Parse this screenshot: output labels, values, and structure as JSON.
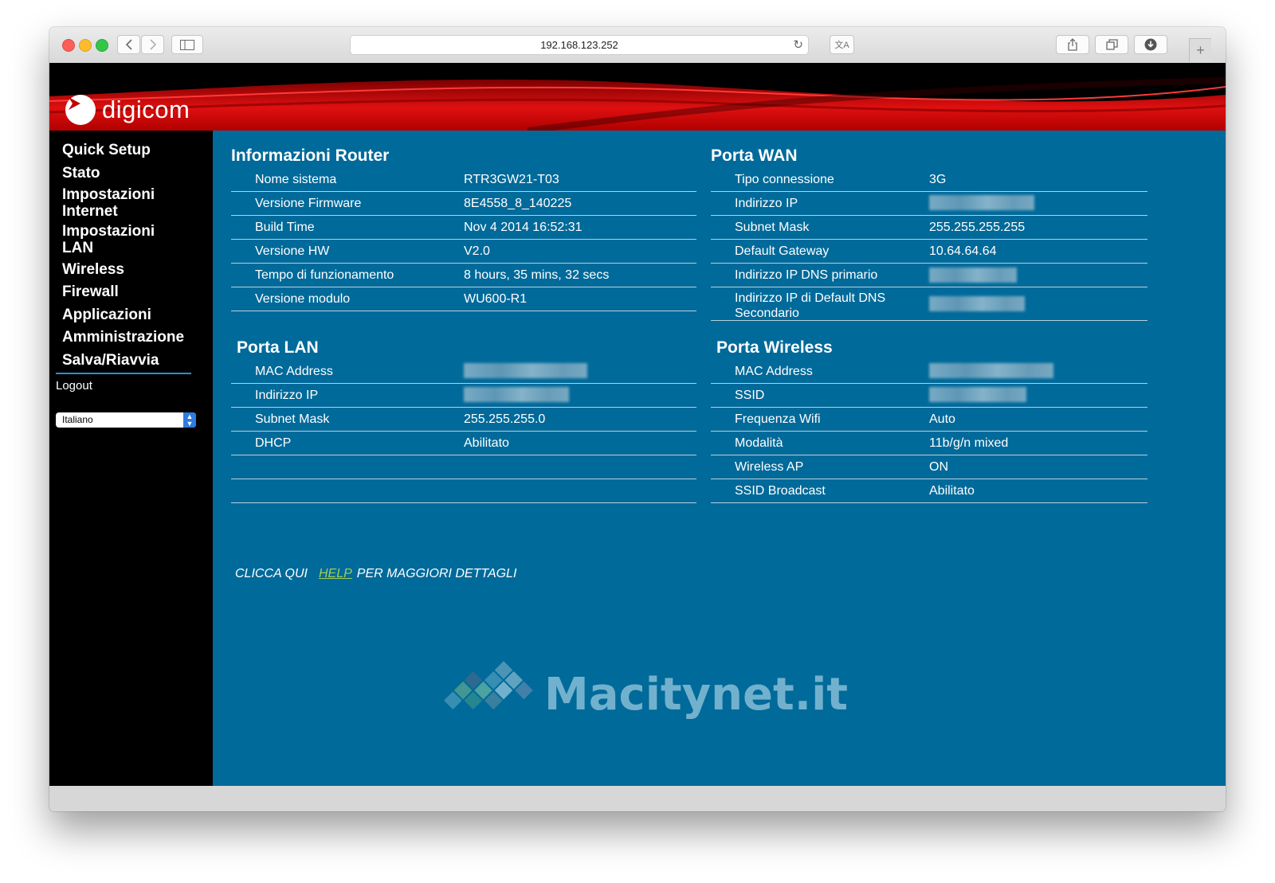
{
  "browser": {
    "url": "192.168.123.252"
  },
  "brand": {
    "logo_text": "digicom",
    "colors": {
      "banner_red": "#d40000",
      "content_bg": "#006a9a",
      "sidebar_bg": "#000000",
      "link_green": "#9fce55"
    }
  },
  "sidebar": {
    "items": [
      {
        "label": "Quick Setup"
      },
      {
        "label": "Stato"
      },
      {
        "label": "Impostazioni Internet"
      },
      {
        "label": "Impostazioni LAN"
      },
      {
        "label": "Wireless"
      },
      {
        "label": "Firewall"
      },
      {
        "label": "Applicazioni"
      },
      {
        "label": "Amministrazione"
      },
      {
        "label": "Salva/Riavvia"
      }
    ],
    "logout": "Logout",
    "language": "Italiano"
  },
  "router_info": {
    "title": "Informazioni Router",
    "rows": [
      {
        "label": "Nome sistema",
        "value": "RTR3GW21-T03"
      },
      {
        "label": "Versione Firmware",
        "value": "8E4558_8_140225"
      },
      {
        "label": "Build Time",
        "value": "Nov 4 2014 16:52:31"
      },
      {
        "label": "Versione HW",
        "value": "V2.0"
      },
      {
        "label": "Tempo di funzionamento",
        "value": "8 hours, 35 mins, 32 secs"
      },
      {
        "label": "Versione modulo",
        "value": "WU600-R1"
      }
    ]
  },
  "wan": {
    "title": "Porta WAN",
    "rows": [
      {
        "label": "Tipo connessione",
        "value": "3G"
      },
      {
        "label": "Indirizzo IP",
        "value": ""
      },
      {
        "label": "Subnet Mask",
        "value": "255.255.255.255"
      },
      {
        "label": "Default Gateway",
        "value": "10.64.64.64"
      },
      {
        "label": "Indirizzo IP DNS primario",
        "value": ""
      },
      {
        "label": "Indirizzo IP di Default DNS Secondario",
        "value": ""
      }
    ]
  },
  "lan": {
    "title": "Porta LAN",
    "rows": [
      {
        "label": "MAC Address",
        "value": ""
      },
      {
        "label": "Indirizzo IP",
        "value": ""
      },
      {
        "label": "Subnet Mask",
        "value": "255.255.255.0"
      },
      {
        "label": "DHCP",
        "value": "Abilitato"
      }
    ]
  },
  "wireless": {
    "title": "Porta Wireless",
    "rows": [
      {
        "label": "MAC Address",
        "value": ""
      },
      {
        "label": "SSID",
        "value": ""
      },
      {
        "label": "Frequenza Wifi",
        "value": "Auto"
      },
      {
        "label": "Modalità",
        "value": "11b/g/n mixed"
      },
      {
        "label": "Wireless AP",
        "value": "ON"
      },
      {
        "label": "SSID Broadcast",
        "value": "Abilitato"
      }
    ]
  },
  "help": {
    "prefix": "CLICCA QUI",
    "link": "HELP",
    "suffix": "PER MAGGIORI DETTAGLI"
  },
  "watermark": {
    "text": "Macitynet.it"
  }
}
